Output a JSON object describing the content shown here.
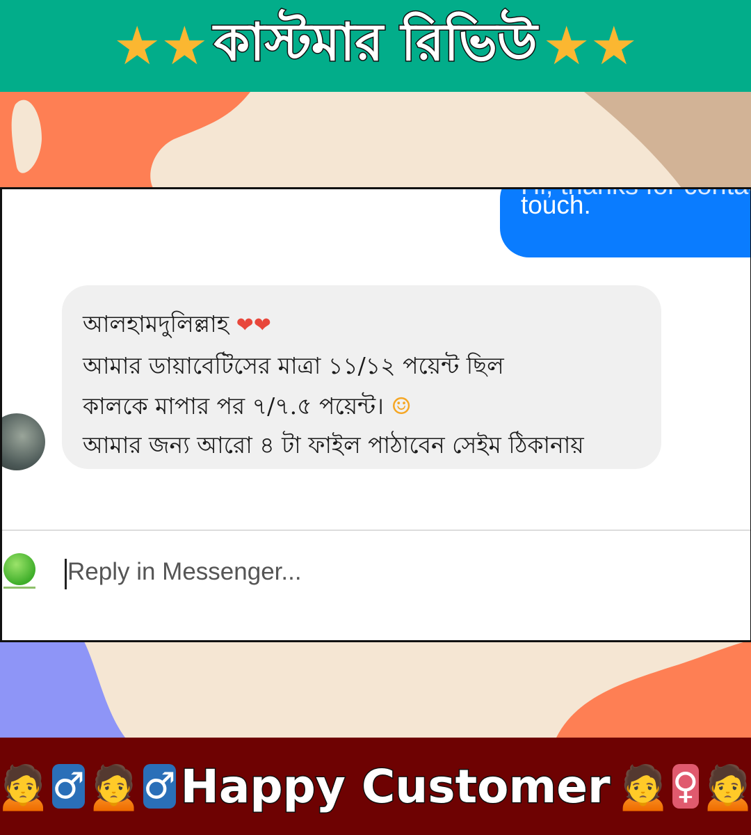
{
  "header": {
    "title": "কাস্টমার রিভিউ",
    "star": "★"
  },
  "chat": {
    "sent_partial": "Hi, thanks for contacting",
    "sent_text": "touch.",
    "received_lines": [
      "আলহামদুলিল্লাহ",
      "আমার ডায়াবেটিসের মাত্রা ১১/১২ পয়েন্ট ছিল",
      "কালকে মাপার পর ৭/৭.৫ পয়েন্ট।",
      "আমার জন্য আরো ৪ টা ফাইল পাঠাবেন সেইম ঠিকানায়"
    ],
    "hearts": "❤❤",
    "smiley": "☺",
    "reply_placeholder": "Reply in Messenger..."
  },
  "footer": {
    "title": "Happy Customer",
    "male_sign": "♂",
    "female_sign": "♀",
    "person_emoji": "🙍"
  },
  "colors": {
    "header_bg": "#02ad8a",
    "star": "#fbb731",
    "messenger_blue": "#0a7cff",
    "footer_bg": "#6e0202"
  }
}
